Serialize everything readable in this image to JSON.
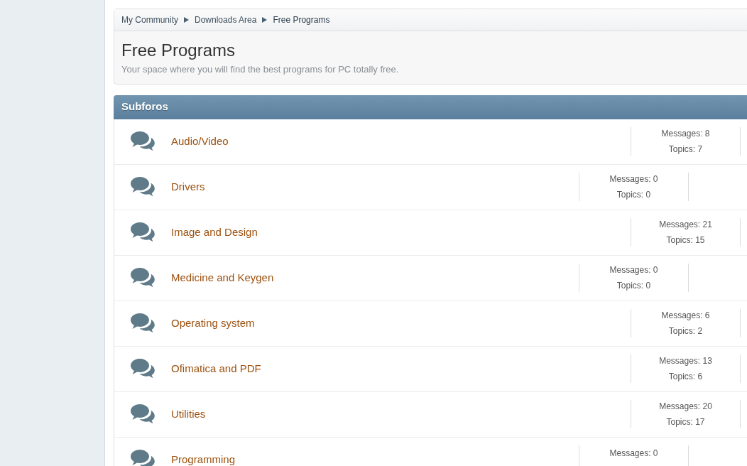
{
  "breadcrumb": [
    {
      "label": "My Community",
      "selected": false
    },
    {
      "label": "Downloads Area",
      "selected": false
    },
    {
      "label": "Free Programs",
      "selected": true
    }
  ],
  "page": {
    "title": "Free Programs",
    "description": "Your space where you will find the best programs for PC totally free."
  },
  "section": {
    "title": "Subforos"
  },
  "forums": [
    {
      "name": "Audio/Video",
      "kind": "active",
      "messages": "Messages: 8",
      "topics": "Topics: 7"
    },
    {
      "name": "Drivers",
      "kind": "empty",
      "messages": "Messages: 0",
      "topics": "Topics: 0"
    },
    {
      "name": "Image and Design",
      "kind": "active",
      "messages": "Messages: 21",
      "topics": "Topics: 15"
    },
    {
      "name": "Medicine and Keygen",
      "kind": "empty",
      "messages": "Messages: 0",
      "topics": "Topics: 0"
    },
    {
      "name": "Operating system",
      "kind": "active",
      "messages": "Messages: 6",
      "topics": "Topics: 2"
    },
    {
      "name": "Ofimatica and PDF",
      "kind": "active",
      "messages": "Messages: 13",
      "topics": "Topics: 6"
    },
    {
      "name": "Utilities",
      "kind": "active",
      "messages": "Messages: 20",
      "topics": "Topics: 17"
    },
    {
      "name": "Programming",
      "kind": "empty",
      "messages": "Messages: 0"
    }
  ]
}
